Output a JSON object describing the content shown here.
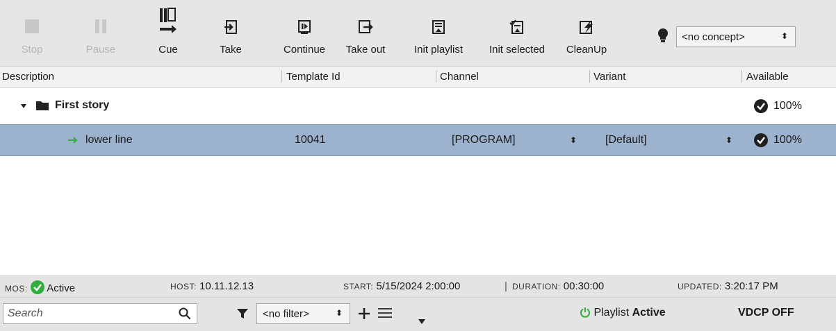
{
  "toolbar": {
    "buttons": [
      {
        "label": "Stop",
        "enabled": false,
        "icon": "stop-icon"
      },
      {
        "label": "Pause",
        "enabled": false,
        "icon": "pause-icon"
      },
      {
        "label": "Cue",
        "enabled": true,
        "icon": "cue-icon"
      },
      {
        "label": "Take",
        "enabled": true,
        "icon": "take-icon"
      },
      {
        "label": "Continue",
        "enabled": true,
        "icon": "continue-icon"
      },
      {
        "label": "Take out",
        "enabled": true,
        "icon": "take-out-icon"
      },
      {
        "label": "Init playlist",
        "enabled": true,
        "icon": "init-playlist-icon"
      },
      {
        "label": "Init selected",
        "enabled": true,
        "icon": "init-selected-icon"
      },
      {
        "label": "CleanUp",
        "enabled": true,
        "icon": "cleanup-icon"
      }
    ],
    "concept_value": "<no concept>"
  },
  "columns": [
    "Description",
    "Template Id",
    "Channel",
    "Variant",
    "Available"
  ],
  "group": {
    "name": "First story",
    "available": "100%"
  },
  "item": {
    "description": "lower line",
    "template_id": "10041",
    "channel": "[PROGRAM]",
    "variant": "[Default]",
    "available": "100%"
  },
  "status": {
    "mos_label": "MOS:",
    "mos_value": "Active",
    "host_label": "HOST:",
    "host_value": "10.11.12.13",
    "start_label": "START:",
    "start_value": "5/15/2024 2:00:00",
    "duration_label": "DURATION:",
    "duration_value": "00:30:00",
    "updated_label": "UPDATED:",
    "updated_value": "3:20:17 PM"
  },
  "bottom": {
    "search_placeholder": "Search",
    "filter_value": "<no filter>",
    "playlist_prefix": "Playlist",
    "playlist_state": "Active",
    "vdcp": "VDCP OFF"
  },
  "colors": {
    "selection": "#9db3cd",
    "active_green": "#2fae3c",
    "toolbar_bg": "#e6e6e6"
  }
}
